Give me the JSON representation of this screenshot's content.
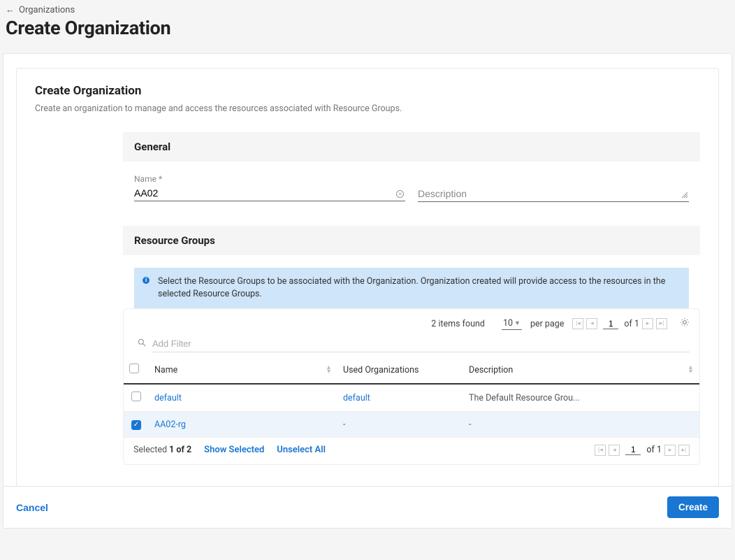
{
  "breadcrumb": {
    "label": "Organizations"
  },
  "page": {
    "title": "Create Organization"
  },
  "panel": {
    "title": "Create Organization",
    "desc": "Create an organization to manage and access the resources associated with Resource Groups."
  },
  "general": {
    "heading": "General",
    "name_label": "Name *",
    "name_value": "AA02",
    "desc_placeholder": "Description"
  },
  "rg": {
    "heading": "Resource Groups",
    "info": "Select the Resource Groups to be associated with the Organization. Organization created will provide access to the resources in the selected Resource Groups."
  },
  "toolbar": {
    "items_found": "2 items found",
    "per_page_value": "10",
    "per_page_label": "per page",
    "page_current": "1",
    "page_total": "of 1",
    "filter_placeholder": "Add Filter"
  },
  "table": {
    "cols": {
      "name": "Name",
      "used": "Used Organizations",
      "desc": "Description"
    },
    "rows": [
      {
        "checked": false,
        "name": "default",
        "used": "default",
        "desc": "The Default Resource Grou..."
      },
      {
        "checked": true,
        "name": "AA02-rg",
        "used": "-",
        "desc": "-"
      }
    ]
  },
  "selection": {
    "prefix": "Selected ",
    "count": "1 of 2",
    "show_selected": "Show Selected",
    "unselect_all": "Unselect All"
  },
  "pager2": {
    "page_current": "1",
    "page_total": "of 1"
  },
  "actions": {
    "cancel": "Cancel",
    "create": "Create"
  }
}
